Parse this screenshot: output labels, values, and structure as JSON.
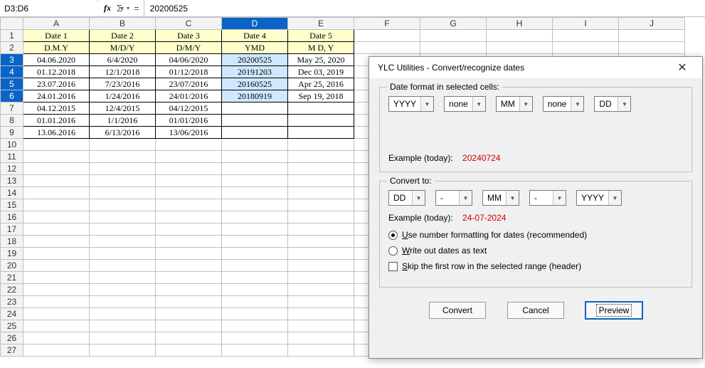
{
  "formula_bar": {
    "cell_ref": "D3:D6",
    "fx_label": "fx",
    "sigma": "Σ",
    "eq": "=",
    "formula_value": "20200525"
  },
  "cols": [
    "A",
    "B",
    "C",
    "D",
    "E",
    "F",
    "G",
    "H",
    "I",
    "J"
  ],
  "header_row": [
    "Date 1",
    "Date 2",
    "Date 3",
    "Date 4",
    "Date 5"
  ],
  "sub_row": [
    "D.M.Y",
    "M/D/Y",
    "D/M/Y",
    "YMD",
    "M D, Y"
  ],
  "data": [
    [
      "04.06.2020",
      "6/4/2020",
      "04/06/2020",
      "20200525",
      "May 25, 2020"
    ],
    [
      "01.12.2018",
      "12/1/2018",
      "01/12/2018",
      "20191203",
      "Dec 03, 2019"
    ],
    [
      "23.07.2016",
      "7/23/2016",
      "23/07/2016",
      "20160525",
      "Apr 25, 2016"
    ],
    [
      "24.01.2016",
      "1/24/2016",
      "24/01/2016",
      "20180919",
      "Sep 19, 2018"
    ],
    [
      "04.12.2015",
      "12/4/2015",
      "04/12/2015",
      "",
      ""
    ],
    [
      "01.01.2016",
      "1/1/2016",
      "01/01/2016",
      "",
      ""
    ],
    [
      "13.06.2016",
      "6/13/2016",
      "13/06/2016",
      "",
      ""
    ]
  ],
  "dialog": {
    "title": "YLC Utilities - Convert/recognize dates",
    "group1": {
      "legend": "Date format in selected cells:",
      "fields": [
        "YYYY",
        "none",
        "MM",
        "none",
        "DD"
      ],
      "example_label": "Example (today):",
      "example_value": "20240724"
    },
    "group2": {
      "legend": "Convert to:",
      "fields": [
        "DD",
        "-",
        "MM",
        "-",
        "YYYY"
      ],
      "example_label": "Example (today):",
      "example_value": "24-07-2024",
      "radio1": "Use number formatting for dates (recommended)",
      "radio1_accel": "U",
      "radio2": "Write out dates as text",
      "radio2_accel": "W",
      "check1": "Skip the first row in the selected range (header)",
      "check1_accel": "S"
    },
    "buttons": {
      "convert": "Convert",
      "cancel": "Cancel",
      "preview": "Preview"
    }
  }
}
